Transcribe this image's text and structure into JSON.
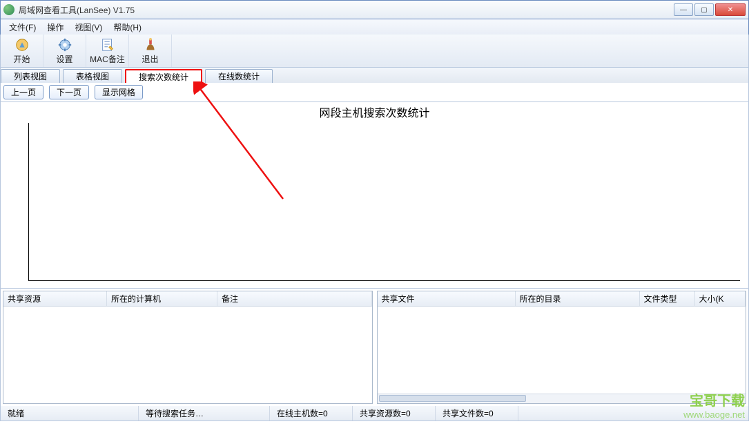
{
  "window": {
    "title": "局域网查看工具(LanSee) V1.75"
  },
  "menu": {
    "file": "文件(F)",
    "operate": "操作",
    "view": "视图(V)",
    "help": "帮助(H)"
  },
  "toolbar": {
    "start": "开始",
    "settings": "设置",
    "macnote": "MAC备注",
    "exit": "退出"
  },
  "tabs": {
    "listview": "列表视图",
    "tableview": "表格视图",
    "searchstats": "搜索次数统计",
    "onlinestats": "在线数统计"
  },
  "subtoolbar": {
    "prev": "上一页",
    "next": "下一页",
    "showgrid": "显示网格"
  },
  "chart": {
    "title": "网段主机搜索次数统计"
  },
  "panel_left": {
    "cols": [
      "共享资源",
      "所在的计算机",
      "备注"
    ]
  },
  "panel_right": {
    "cols": [
      "共享文件",
      "所在的目录",
      "文件类型",
      "大小(K"
    ]
  },
  "status": {
    "ready": "就绪",
    "waiting": "等待搜索任务…",
    "online_hosts": "在线主机数=0",
    "shared_res": "共享资源数=0",
    "shared_files": "共享文件数=0"
  },
  "watermark": {
    "line1": "宝哥下载",
    "line2": "www.baoge.net"
  },
  "chart_data": {
    "type": "bar",
    "title": "网段主机搜索次数统计",
    "categories": [],
    "values": [],
    "xlabel": "",
    "ylabel": "",
    "ylim": [
      0,
      0
    ]
  }
}
